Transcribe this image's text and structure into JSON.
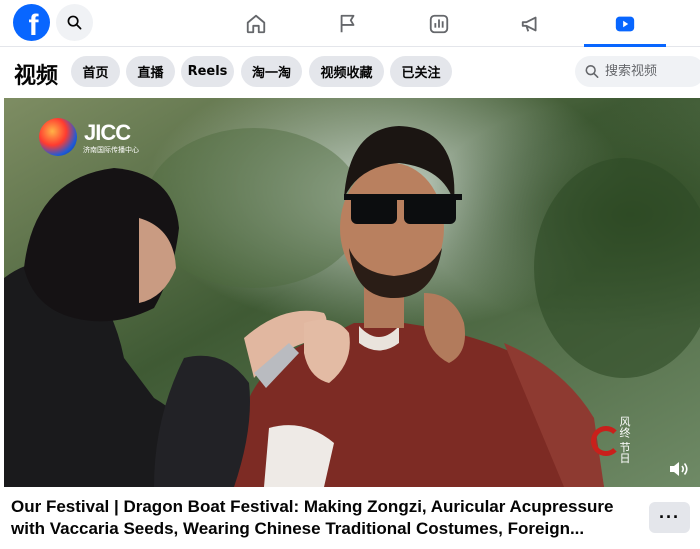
{
  "brand": {
    "logo_letter": "f",
    "accent": "#0866ff"
  },
  "topnav": {
    "tabs": [
      {
        "icon": "home-icon",
        "active": false
      },
      {
        "icon": "flag-icon",
        "active": false
      },
      {
        "icon": "dashboard-icon",
        "active": false
      },
      {
        "icon": "megaphone-icon",
        "active": false
      },
      {
        "icon": "video-play-icon",
        "active": true
      }
    ]
  },
  "subheader": {
    "title": "视频",
    "chips": [
      "首页",
      "直播",
      "Reels",
      "淘一淘",
      "视频收藏",
      "已关注"
    ],
    "search_placeholder": "搜索视频"
  },
  "video": {
    "watermark_logo": "JICC",
    "watermark_sub": "济南国际传播中心",
    "stamp_text": "风终 节日",
    "volume_icon": "volume-icon"
  },
  "caption": {
    "title": "Our Festival | Dragon Boat Festival: Making Zongzi, Auricular Acupressure with Vaccaria Seeds, Wearing Chinese Traditional Costumes, Foreign...",
    "more_label": "···"
  }
}
